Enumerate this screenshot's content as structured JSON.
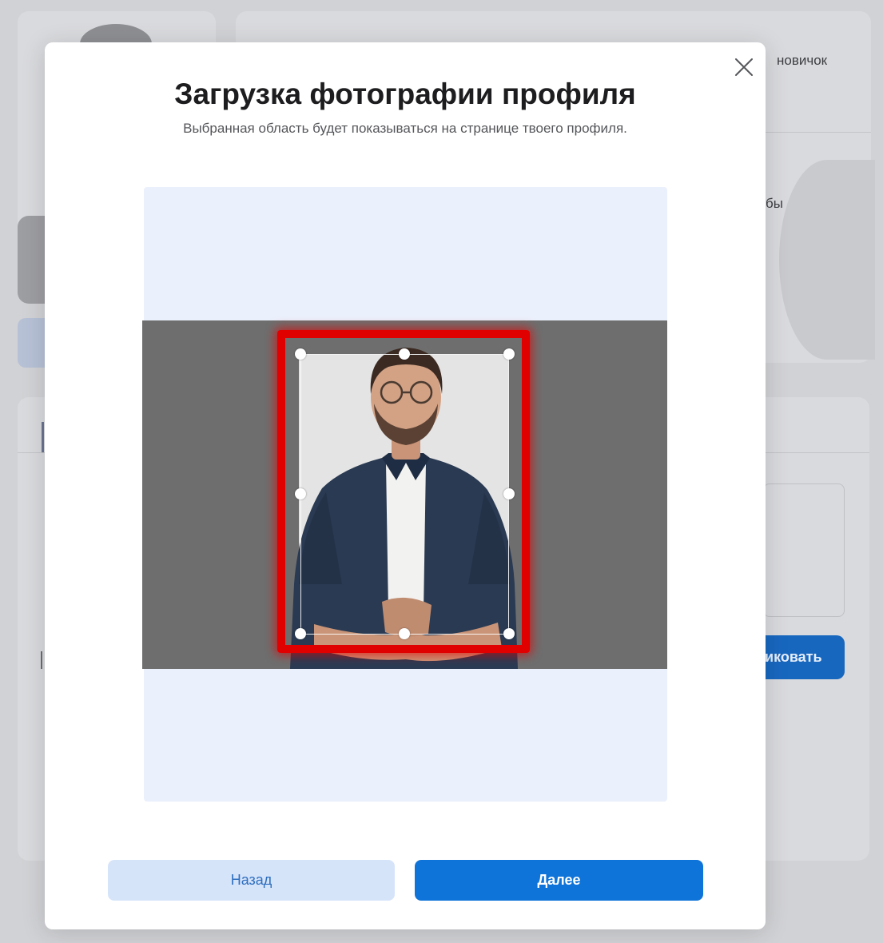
{
  "background": {
    "rank_label": "новичок",
    "snippet_text": "бы",
    "publish_button_partial": "иковать"
  },
  "modal": {
    "title": "Загрузка фотографии профиля",
    "subtitle": "Выбранная область будет показываться на странице твоего профиля.",
    "close_icon": "close-icon",
    "back_label": "Назад",
    "next_label": "Далее"
  },
  "colors": {
    "primary": "#0f74d9",
    "secondary": "#d6e4fa",
    "crop_background": "#eaf0fc",
    "highlight": "#e00000"
  }
}
